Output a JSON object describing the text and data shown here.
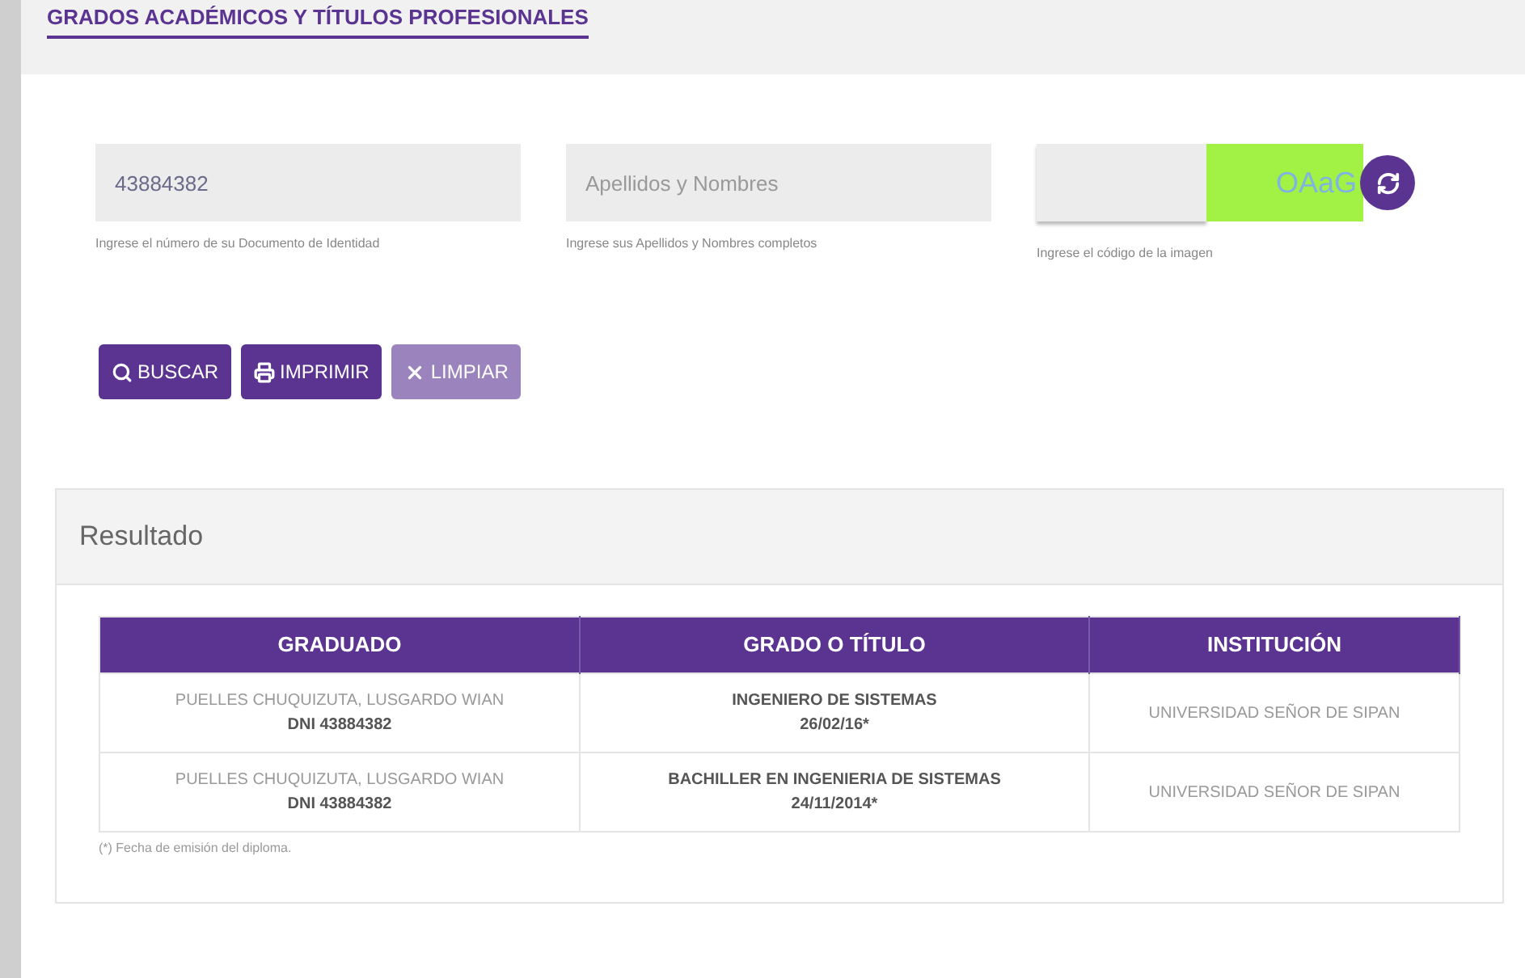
{
  "tab": {
    "label": "GRADOS ACADÉMICOS Y TÍTULOS PROFESIONALES",
    "selected": true
  },
  "fields": [
    {
      "value": "43884382",
      "help": "Ingrese el número de su Documento de Identidad"
    },
    {
      "placeholder": "Apellidos y Nombres",
      "help": "Ingrese sus Apellidos y Nombres completos"
    }
  ],
  "captcha": {
    "image_text": "OAaG",
    "help": "Ingrese el código de la imagen"
  },
  "buttons": [
    {
      "label": "BUSCAR",
      "kind": "search",
      "disabled": false
    },
    {
      "label": "IMPRIMIR",
      "kind": "print",
      "disabled": false
    },
    {
      "label": "LIMPIAR",
      "kind": "clear",
      "disabled": true
    }
  ],
  "result": {
    "title": "Resultado",
    "table": {
      "columns": [
        "GRADUADO",
        "GRADO O TÍTULO",
        "INSTITUCIÓN"
      ],
      "rows": [
        {
          "name": "PUELLES CHUQUIZUTA, LUSGARDO WIAN",
          "dni": "DNI 43884382",
          "degree": "INGENIERO DE SISTEMAS",
          "date": "26/02/16*",
          "institution": "UNIVERSIDAD SEÑOR DE SIPAN"
        },
        {
          "name": "PUELLES CHUQUIZUTA, LUSGARDO WIAN",
          "dni": "DNI 43884382",
          "degree": "BACHILLER EN INGENIERIA DE SISTEMAS",
          "date": "24/11/2014*",
          "institution": "UNIVERSIDAD SEÑOR DE SIPAN"
        }
      ]
    },
    "footnote": "(*) Fecha de emisión del diploma."
  }
}
